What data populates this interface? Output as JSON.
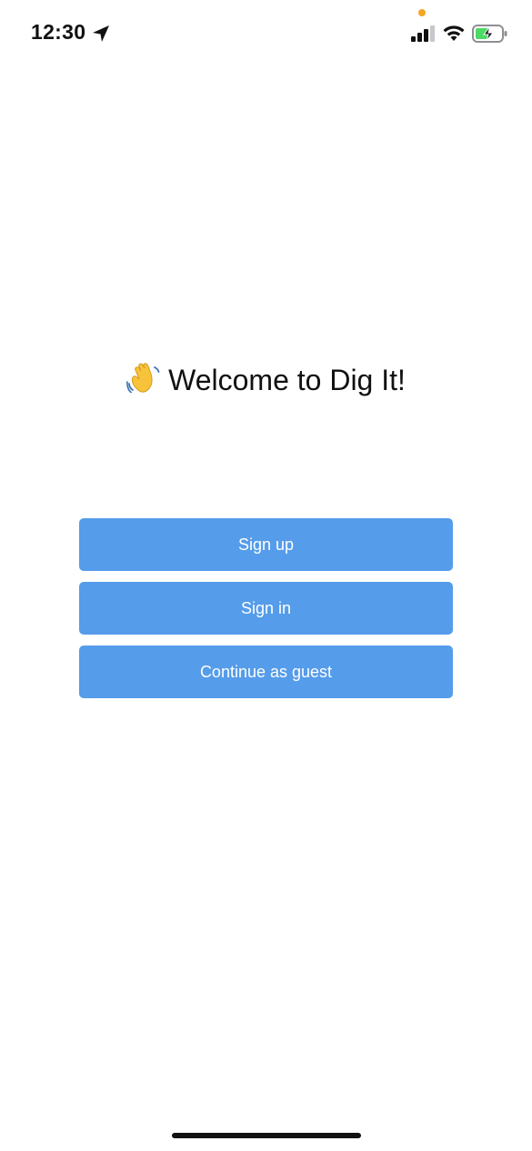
{
  "status_bar": {
    "time": "12:30",
    "icons": {
      "location": "location-arrow-icon",
      "signal": "cellular-signal-icon",
      "wifi": "wifi-icon",
      "battery": "battery-charging-icon"
    },
    "privacy_dot_color": "#f5a623",
    "battery_color": "#4cd964"
  },
  "welcome": {
    "emoji_icon": "waving-hand-icon",
    "title": "Welcome to Dig It!"
  },
  "actions": {
    "sign_up_label": "Sign up",
    "sign_in_label": "Sign in",
    "guest_label": "Continue as guest"
  },
  "colors": {
    "button_bg": "#559cea",
    "button_text": "#ffffff",
    "background": "#ffffff"
  }
}
